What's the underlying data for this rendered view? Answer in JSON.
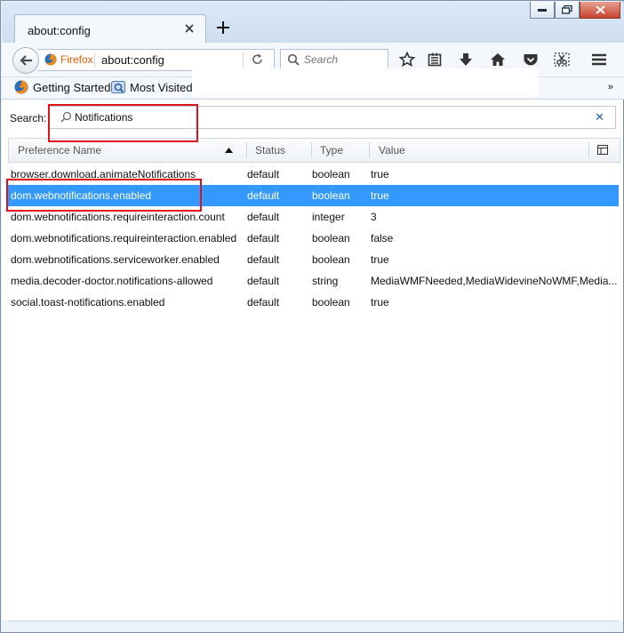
{
  "window": {
    "tab_title": "about:config",
    "new_tab_symbol": "+"
  },
  "navbar": {
    "identity_label": "Firefox",
    "url": "about:config",
    "search_placeholder": "Search"
  },
  "bookmarks": {
    "items": [
      {
        "label": "Getting Started",
        "icon": "firefox-logo-icon"
      },
      {
        "label": "Most Visited",
        "icon": "most-visited-icon"
      }
    ],
    "overflow": "»"
  },
  "config": {
    "search_label": "Search:",
    "search_value": "Notifications",
    "columns": [
      "Preference Name",
      "Status",
      "Type",
      "Value"
    ],
    "rows": [
      {
        "name": "browser.download.animateNotifications",
        "status": "default",
        "type": "boolean",
        "value": "true"
      },
      {
        "name": "dom.webnotifications.enabled",
        "status": "default",
        "type": "boolean",
        "value": "true",
        "selected": true
      },
      {
        "name": "dom.webnotifications.requireinteraction.count",
        "status": "default",
        "type": "integer",
        "value": "3"
      },
      {
        "name": "dom.webnotifications.requireinteraction.enabled",
        "status": "default",
        "type": "boolean",
        "value": "false"
      },
      {
        "name": "dom.webnotifications.serviceworker.enabled",
        "status": "default",
        "type": "boolean",
        "value": "true"
      },
      {
        "name": "media.decoder-doctor.notifications-allowed",
        "status": "default",
        "type": "string",
        "value": "MediaWMFNeeded,MediaWidevineNoWMF,Media..."
      },
      {
        "name": "social.toast-notifications.enabled",
        "status": "default",
        "type": "boolean",
        "value": "true"
      }
    ]
  },
  "colors": {
    "selection": "#3399ff",
    "highlight_box": "#e0121a",
    "firefox_orange": "#e66000"
  }
}
